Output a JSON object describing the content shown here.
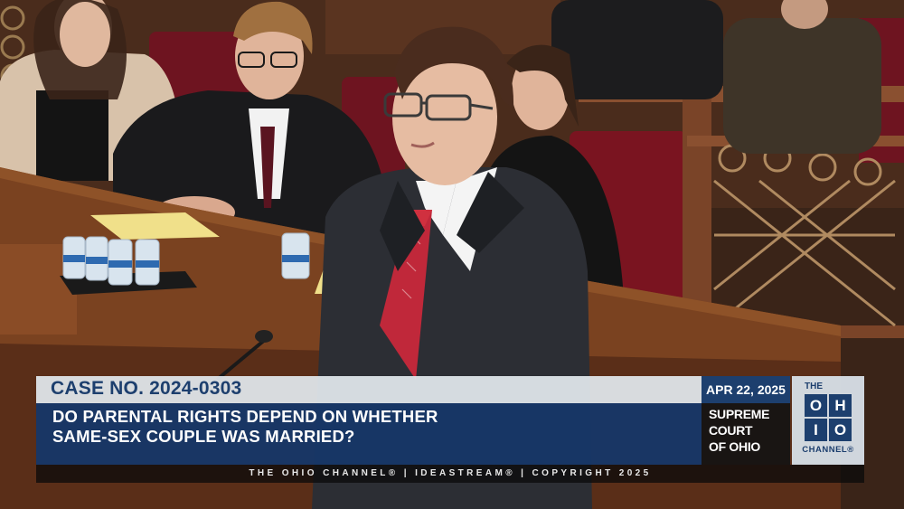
{
  "broadcast": {
    "case_number": "CASE NO. 2024-0303",
    "headline_line1": "DO PARENTAL RIGHTS DEPEND ON WHETHER",
    "headline_line2": "SAME-SEX COUPLE WAS MARRIED?",
    "date": "APR 22, 2025",
    "court_line1": "SUPREME",
    "court_line2": "COURT",
    "court_line3": "OF OHIO",
    "credit": "THE OHIO CHANNEL® | IDEASTREAM® | COPYRIGHT 2025"
  },
  "logo": {
    "the": "THE",
    "letters": [
      "O",
      "H",
      "I",
      "O"
    ],
    "channel": "CHANNEL®"
  },
  "colors": {
    "navy": "#1d3f6e",
    "case_bar": "#e2e8ee",
    "wood": "#6b3a1f",
    "seat": "#7a1420"
  }
}
